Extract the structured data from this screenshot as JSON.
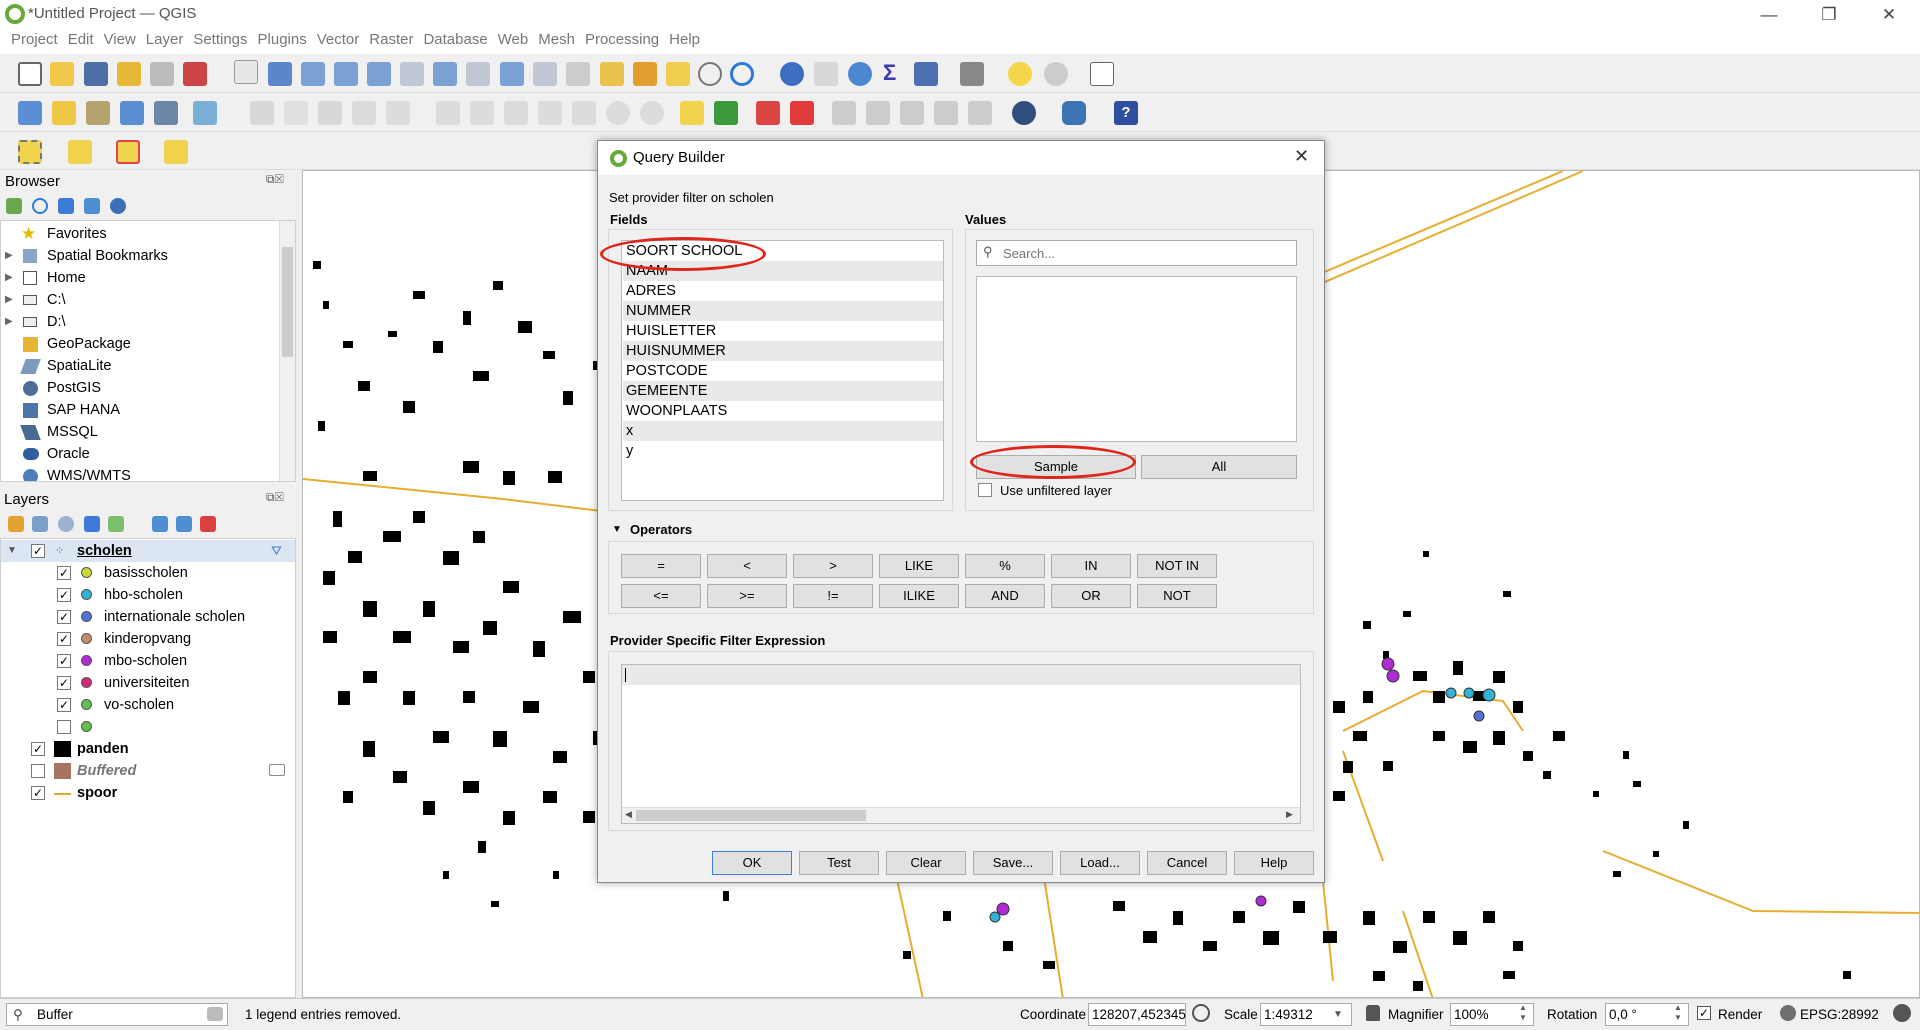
{
  "window": {
    "title": "*Untitled Project — QGIS",
    "min": "—",
    "restore": "❐",
    "close": "✕"
  },
  "menu": [
    "Project",
    "Edit",
    "View",
    "Layer",
    "Settings",
    "Plugins",
    "Vector",
    "Raster",
    "Database",
    "Web",
    "Mesh",
    "Processing",
    "Help"
  ],
  "browser": {
    "title": "Browser",
    "items": [
      "Favorites",
      "Spatial Bookmarks",
      "Home",
      "C:\\",
      "D:\\",
      "GeoPackage",
      "SpatiaLite",
      "PostGIS",
      "SAP HANA",
      "MSSQL",
      "Oracle",
      "WMS/WMTS"
    ]
  },
  "layers": {
    "title": "Layers",
    "group": "scholen",
    "sub": [
      {
        "label": "basisscholen",
        "color": "#c9d93a"
      },
      {
        "label": "hbo-scholen",
        "color": "#35b0d6"
      },
      {
        "label": "internationale scholen",
        "color": "#4f73d8"
      },
      {
        "label": "kinderopvang",
        "color": "#c98a6b"
      },
      {
        "label": "mbo-scholen",
        "color": "#b02ad6"
      },
      {
        "label": "universiteiten",
        "color": "#d6287a"
      },
      {
        "label": "vo-scholen",
        "color": "#5fc24a"
      },
      {
        "label": "",
        "color": "#5fc24a"
      }
    ],
    "others": [
      {
        "label": "panden",
        "checked": true
      },
      {
        "label": "Buffered",
        "checked": false
      },
      {
        "label": "spoor",
        "checked": true
      }
    ]
  },
  "dialog": {
    "title": "Query Builder",
    "subtitle": "Set provider filter on scholen",
    "fields_label": "Fields",
    "values_label": "Values",
    "fields": [
      "SOORT SCHOOL",
      "NAAM",
      "ADRES",
      "NUMMER",
      "HUISLETTER",
      "HUISNUMMER",
      "POSTCODE",
      "GEMEENTE",
      "WOONPLAATS",
      "x",
      "y"
    ],
    "search_placeholder": "Search...",
    "sample": "Sample",
    "all": "All",
    "unfiltered": "Use unfiltered layer",
    "operators_label": "Operators",
    "ops_row1": [
      "=",
      "<",
      ">",
      "LIKE",
      "%",
      "IN",
      "NOT IN"
    ],
    "ops_row2": [
      "<=",
      ">=",
      "!=",
      "ILIKE",
      "AND",
      "OR",
      "NOT"
    ],
    "expr_label": "Provider Specific Filter Expression",
    "buttons": [
      "OK",
      "Test",
      "Clear",
      "Save...",
      "Load...",
      "Cancel",
      "Help"
    ]
  },
  "status": {
    "search": "Buffer",
    "message": "1 legend entries removed.",
    "coord_label": "Coordinate",
    "coord": "128207,452345",
    "scale_label": "Scale",
    "scale": "1:49312",
    "magnifier_label": "Magnifier",
    "magnifier": "100%",
    "rotation_label": "Rotation",
    "rotation": "0,0 °",
    "render": "Render",
    "epsg": "EPSG:28992"
  }
}
